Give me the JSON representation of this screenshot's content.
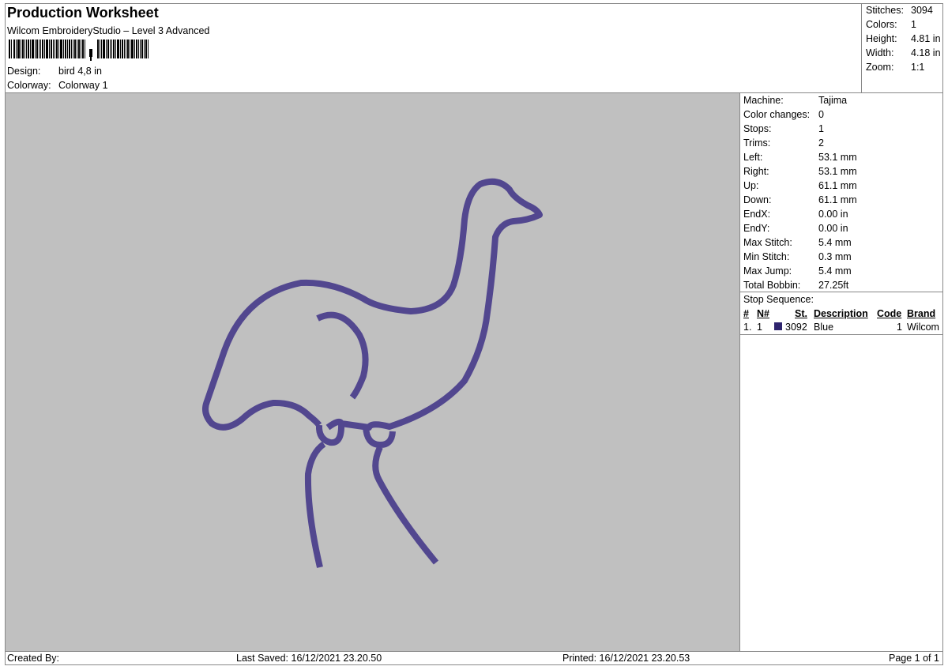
{
  "header": {
    "title": "Production Worksheet",
    "subtitle": "Wilcom EmbroideryStudio – Level 3 Advanced",
    "design_label": "Design:",
    "design_value": "bird 4,8 in",
    "colorway_label": "Colorway:",
    "colorway_value": "Colorway 1"
  },
  "summary": {
    "stitches_label": "Stitches:",
    "stitches": "3094",
    "colors_label": "Colors:",
    "colors": "1",
    "height_label": "Height:",
    "height": "4.81 in",
    "width_label": "Width:",
    "width": "4.18 in",
    "zoom_label": "Zoom:",
    "zoom": "1:1"
  },
  "machine": {
    "rows": [
      {
        "label": "Machine:",
        "value": "Tajima"
      },
      {
        "label": "Color changes:",
        "value": "0"
      },
      {
        "label": "Stops:",
        "value": "1"
      },
      {
        "label": "Trims:",
        "value": "2"
      },
      {
        "label": "Left:",
        "value": "53.1 mm"
      },
      {
        "label": "Right:",
        "value": "53.1 mm"
      },
      {
        "label": "Up:",
        "value": "61.1 mm"
      },
      {
        "label": "Down:",
        "value": "61.1 mm"
      },
      {
        "label": "EndX:",
        "value": "0.00 in"
      },
      {
        "label": "EndY:",
        "value": "0.00 in"
      },
      {
        "label": "Max Stitch:",
        "value": "5.4 mm"
      },
      {
        "label": "Min Stitch:",
        "value": "0.3 mm"
      },
      {
        "label": "Max Jump:",
        "value": "5.4 mm"
      },
      {
        "label": "Total Bobbin:",
        "value": "27.25ft"
      }
    ]
  },
  "stop_sequence": {
    "title": "Stop Sequence:",
    "headers": {
      "num": "#",
      "n": "N#",
      "st": "St.",
      "description": "Description",
      "code": "Code",
      "brand": "Brand"
    },
    "rows": [
      {
        "num": "1.",
        "n": "1",
        "swatch": "#2e246e",
        "st": "3092",
        "description": "Blue",
        "code": "1",
        "brand": "Wilcom"
      }
    ]
  },
  "design": {
    "thread_color": "#52478f",
    "background": "#c0c0c0"
  },
  "footer": {
    "created_by": "Created By:",
    "last_saved": "Last Saved: 16/12/2021 23.20.50",
    "printed": "Printed: 16/12/2021 23.20.53",
    "page": "Page 1 of 1"
  }
}
